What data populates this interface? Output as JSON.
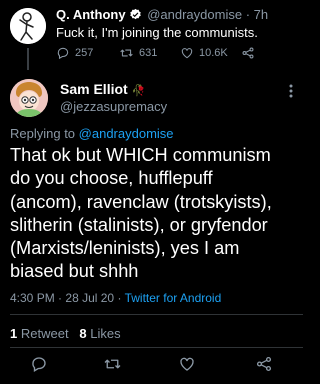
{
  "parent_tweet": {
    "name": "Q. Anthony",
    "handle": "@andraydomise",
    "separator": "·",
    "time": "7h",
    "text": "Fuck it, I'm joining the communists.",
    "replies": "257",
    "retweets": "631",
    "likes": "10.6K"
  },
  "main_tweet": {
    "name": "Sam Elliot",
    "name_emoji": "🥀",
    "handle": "@jezzasupremacy",
    "replying_prefix": "Replying to",
    "replying_handle": "@andraydomise",
    "text": "That ok but WHICH communism\ndo you choose, hufflepuff\n(ancom), ravenclaw (trotskyists),\nslitherin (stalinists), or gryfendor\n(Marxists/leninists), yes I am\nbiased but shhh",
    "time": "4:30 PM",
    "date": "28 Jul 20",
    "meta_separator": "·",
    "source": "Twitter for Android",
    "retweet_count": "1",
    "retweet_label": "Retweet",
    "like_count": "8",
    "like_label": "Likes"
  },
  "icons": [
    "verified-icon",
    "reply-icon",
    "retweet-icon",
    "like-icon",
    "share-icon",
    "more-icon"
  ],
  "colors": {
    "background": "#000000",
    "text": "#ffffff",
    "muted": "#8b98a5",
    "link": "#1da1f2",
    "verified": "#ffffff"
  }
}
